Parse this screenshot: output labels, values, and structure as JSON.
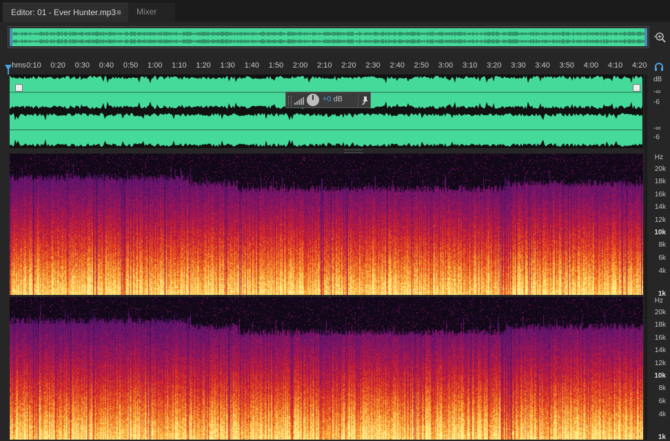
{
  "tabs": {
    "editor_label": "Editor: 01 - Ever Hunter.mp3",
    "editor_menu": "≡",
    "mixer_label": "Mixer"
  },
  "timeline": {
    "unit": "hms",
    "ticks": [
      "0:10",
      "0:20",
      "0:30",
      "0:40",
      "0:50",
      "1:00",
      "1:10",
      "1:20",
      "1:30",
      "1:40",
      "1:50",
      "2:00",
      "2:10",
      "2:20",
      "2:30",
      "2:40",
      "2:50",
      "3:00",
      "3:10",
      "3:20",
      "3:30",
      "3:40",
      "3:50",
      "4:00",
      "4:10",
      "4:20"
    ]
  },
  "hud": {
    "gain_value": "+0",
    "gain_unit": " dB"
  },
  "db_scale": {
    "unit": "dB",
    "ch1_inf": "-∞",
    "ch1_m6": "-6",
    "ch2_inf": "-∞",
    "ch2_m6": "-6"
  },
  "hz_scale": {
    "unit": "Hz",
    "labels": [
      "20k",
      "18k",
      "16k",
      "14k",
      "12k",
      "10k",
      "8k",
      "6k",
      "4k",
      "1k"
    ]
  },
  "colors": {
    "waveform": "#45d99a",
    "accent": "#4aa3df",
    "spectrum_high": "#ffe06a",
    "spectrum_mid": "#e0301c",
    "spectrum_low": "#5a1a7a"
  },
  "icons": {
    "zoom": "magnifier-zoom-icon",
    "monitor": "headphones-icon",
    "pin": "pin-icon"
  }
}
